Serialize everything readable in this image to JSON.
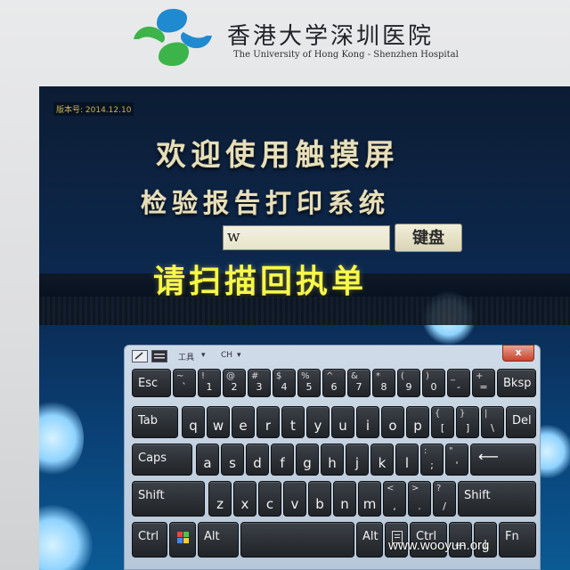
{
  "header": {
    "name_cn": "香港大学深圳医院",
    "name_en": "The University of Hong Kong - Shenzhen Hospital"
  },
  "status": {
    "text": "版本号: 2014.12.10"
  },
  "main": {
    "title_line1": "欢迎使用触摸屏",
    "title_line2": "检验报告打印系统",
    "input_value": "w",
    "keyboard_button": "键盘",
    "prompt": "请扫描回执单"
  },
  "osk": {
    "toolbar": {
      "tools_label": "工具",
      "lang_label": "CH",
      "close_label": "x"
    },
    "rows": [
      [
        {
          "main": "Esc",
          "lower": "",
          "w": "wide"
        },
        {
          "upper": "~",
          "lower": "`"
        },
        {
          "upper": "!",
          "lower": "1"
        },
        {
          "upper": "@",
          "lower": "2"
        },
        {
          "upper": "#",
          "lower": "3"
        },
        {
          "upper": "$",
          "lower": "4"
        },
        {
          "upper": "%",
          "lower": "5"
        },
        {
          "upper": "^",
          "lower": "6"
        },
        {
          "upper": "&",
          "lower": "7"
        },
        {
          "upper": "*",
          "lower": "8"
        },
        {
          "upper": "(",
          "lower": "9"
        },
        {
          "upper": ")",
          "lower": "0"
        },
        {
          "upper": "_",
          "lower": "-"
        },
        {
          "upper": "+",
          "lower": "="
        },
        {
          "main": "Bksp",
          "lower": ""
        }
      ],
      [
        {
          "main": "Tab"
        },
        {
          "main": "q"
        },
        {
          "main": "w"
        },
        {
          "main": "e"
        },
        {
          "main": "r"
        },
        {
          "main": "t"
        },
        {
          "main": "y"
        },
        {
          "main": "u"
        },
        {
          "main": "i"
        },
        {
          "main": "o"
        },
        {
          "main": "p"
        },
        {
          "upper": "{",
          "lower": "["
        },
        {
          "upper": "}",
          "lower": "]"
        },
        {
          "upper": "|",
          "lower": "\\"
        },
        {
          "main": "Del"
        }
      ],
      [
        {
          "main": "Caps"
        },
        {
          "main": "a"
        },
        {
          "main": "s"
        },
        {
          "main": "d"
        },
        {
          "main": "f"
        },
        {
          "main": "g"
        },
        {
          "main": "h"
        },
        {
          "main": "j"
        },
        {
          "main": "k"
        },
        {
          "main": "l"
        },
        {
          "upper": ":",
          "lower": ";"
        },
        {
          "upper": "\"",
          "lower": "'"
        },
        {
          "main": "Enter-arrow"
        }
      ],
      [
        {
          "main": "Shift"
        },
        {
          "main": "z"
        },
        {
          "main": "x"
        },
        {
          "main": "c"
        },
        {
          "main": "v"
        },
        {
          "main": "b"
        },
        {
          "main": "n"
        },
        {
          "main": "m"
        },
        {
          "upper": "<",
          "lower": ","
        },
        {
          "upper": ">",
          "lower": "."
        },
        {
          "upper": "?",
          "lower": "/"
        },
        {
          "main": "Shift"
        }
      ],
      [
        {
          "main": "Ctrl"
        },
        {
          "main": "win-icon"
        },
        {
          "main": "Alt"
        },
        {
          "main": ""
        },
        {
          "main": "Alt"
        },
        {
          "main": "menu-icon"
        },
        {
          "main": "Ctrl"
        },
        {
          "main": "←"
        },
        {
          "main": "↓"
        },
        {
          "main": "→"
        },
        {
          "main": "Fn"
        }
      ]
    ]
  },
  "watermark": "www.wooyun.org",
  "colors": {
    "logo_blue": "#1f8ad0",
    "logo_green": "#3cb44a",
    "prompt_yellow": "#f6f84a"
  }
}
